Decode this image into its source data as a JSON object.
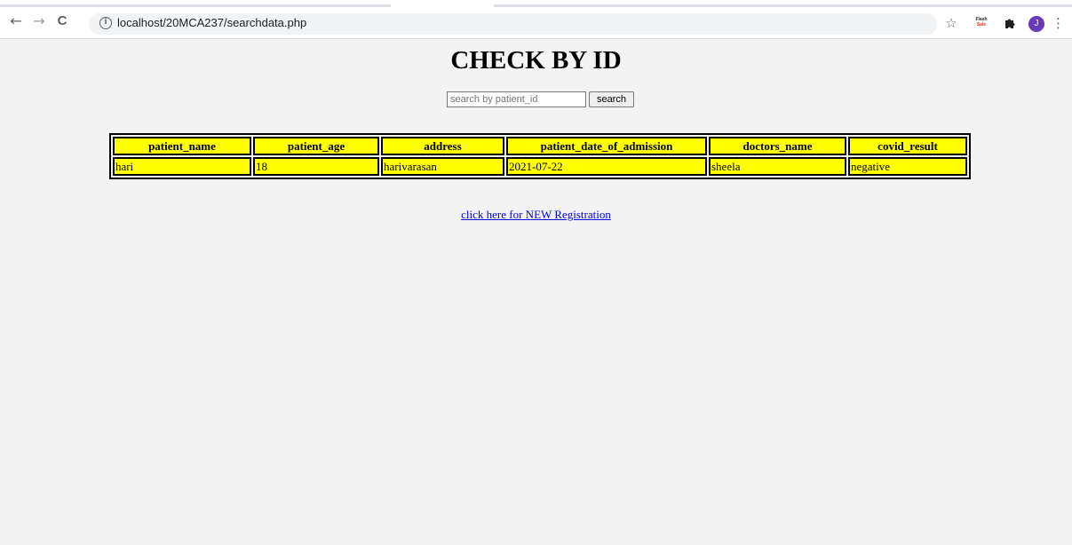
{
  "browser": {
    "url": "localhost/20MCA237/searchdata.php",
    "back_icon": "←",
    "forward_icon": "→",
    "reload_icon": "C",
    "info_icon": "i",
    "star_icon": "☆",
    "flash_line1": "Flash",
    "flash_line2": "Sale",
    "extensions_icon": "puzzle-icon",
    "avatar_letter": "J",
    "menu_icon": "⋮"
  },
  "page": {
    "title": "CHECK BY ID",
    "search": {
      "placeholder": "search by patient_id",
      "button_label": "search"
    },
    "table": {
      "headers": [
        "patient_name",
        "patient_age",
        "address",
        "patient_date_of_admission",
        "doctors_name",
        "covid_result"
      ],
      "rows": [
        [
          "hari",
          "18",
          "harivarasan",
          "2021-07-22",
          "sheela",
          "negative"
        ]
      ]
    },
    "link_text": "click here for NEW Registration"
  },
  "colors": {
    "table_cell_bg": "#ffff00",
    "page_bg": "#f3f3f3",
    "link": "#0000ee",
    "avatar_bg": "#673ab7"
  }
}
